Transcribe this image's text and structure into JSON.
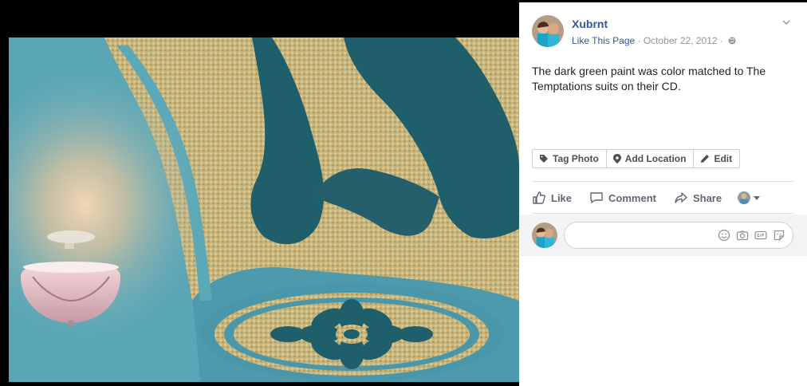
{
  "post": {
    "author": "Xubrnt",
    "meta_link": "Like This Page",
    "meta_separator_1": " · ",
    "date": "October 22, 2012",
    "meta_separator_2": " · ",
    "caption": "The dark green paint was color matched to The Temptations suits on their CD."
  },
  "photo_actions": {
    "tag": "Tag Photo",
    "location": "Add Location",
    "edit": "Edit"
  },
  "reactions": {
    "like": "Like",
    "comment": "Comment",
    "share": "Share"
  },
  "comment_box": {
    "icons": [
      "emoji-icon",
      "camera-icon",
      "gif-icon",
      "sticker-icon"
    ]
  },
  "colors": {
    "link": "#365899",
    "text": "#1d2129",
    "meta_gray": "#90949c",
    "ceiling_teal": "#3f97ad",
    "dark_green_paint": "#1e5f6b",
    "textured_gold": "#c9b981"
  }
}
